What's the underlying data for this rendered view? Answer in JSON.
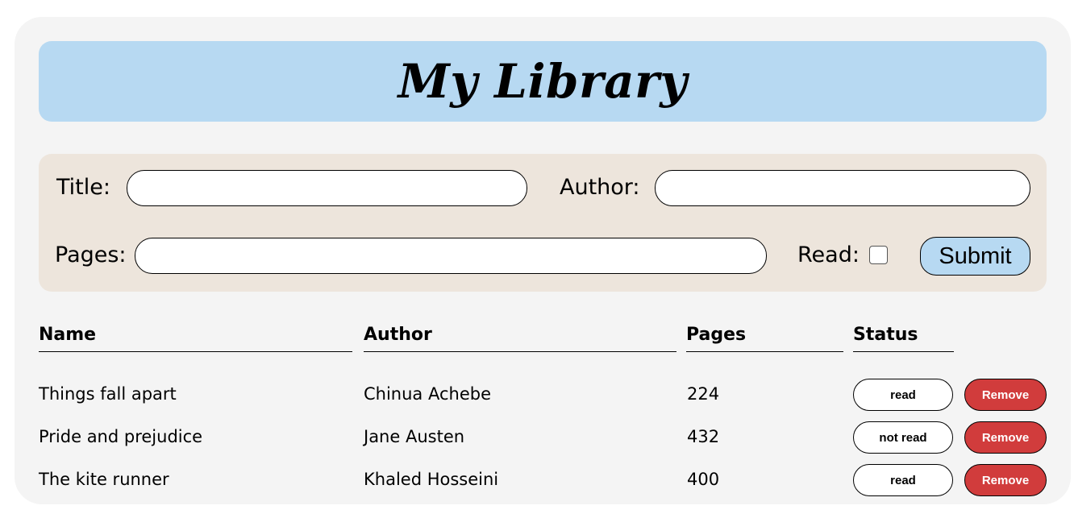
{
  "header": {
    "title": "My Library"
  },
  "form": {
    "title_label": "Title:",
    "title_value": "",
    "author_label": "Author:",
    "author_value": "",
    "pages_label": "Pages:",
    "pages_value": "",
    "read_label": "Read:",
    "read_checked": false,
    "submit_label": "Submit"
  },
  "table": {
    "headers": [
      "Name",
      "Author",
      "Pages",
      "Status"
    ],
    "rows": [
      {
        "name": "Things fall apart",
        "author": "Chinua Achebe",
        "pages": "224",
        "status": "read",
        "remove": "Remove"
      },
      {
        "name": "Pride and prejudice",
        "author": "Jane Austen",
        "pages": "432",
        "status": "not read",
        "remove": "Remove"
      },
      {
        "name": "The kite runner",
        "author": "Khaled Hosseini",
        "pages": "400",
        "status": "read",
        "remove": "Remove"
      }
    ]
  },
  "colors": {
    "header_bg": "#b7d9f2",
    "form_bg": "#ede5dc",
    "card_bg": "#f4f4f4",
    "remove_bg": "#d13c3c",
    "submit_bg": "#b7d9f2"
  }
}
